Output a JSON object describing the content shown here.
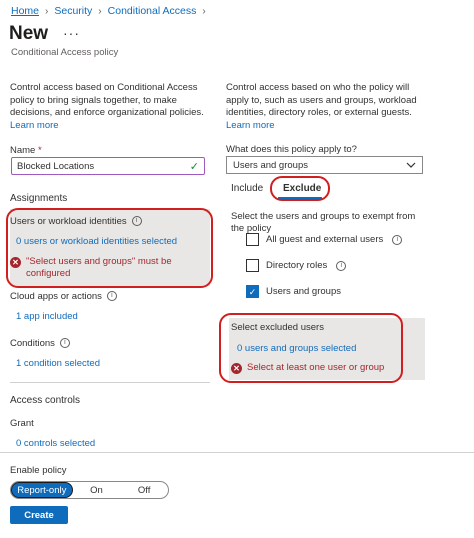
{
  "breadcrumb": {
    "items": [
      "Home",
      "Security",
      "Conditional Access"
    ]
  },
  "header": {
    "title": "New",
    "more_label": "···",
    "subtitle": "Conditional Access policy"
  },
  "left": {
    "description": "Control access based on Conditional Access policy to bring signals together, to make decisions, and enforce organizational policies.",
    "learn_more": "Learn more",
    "name_label": "Name",
    "required_mark": "*",
    "name_value": "Blocked Locations",
    "assignments_heading": "Assignments",
    "users": {
      "label": "Users or workload identities",
      "link": "0 users or workload identities selected",
      "error": "\"Select users and groups\" must be configured"
    },
    "cloud_apps": {
      "label": "Cloud apps or actions",
      "link": "1 app included"
    },
    "conditions": {
      "label": "Conditions",
      "link": "1 condition selected"
    },
    "access_controls_heading": "Access controls",
    "grant": {
      "label": "Grant",
      "link": "0 controls selected"
    }
  },
  "right": {
    "description": "Control access based on who the policy will apply to, such as users and groups, workload identities, directory roles, or external guests.",
    "learn_more": "Learn more",
    "apply_question": "What does this policy apply to?",
    "apply_value": "Users and groups",
    "tabs": [
      {
        "label": "Include"
      },
      {
        "label": "Exclude"
      }
    ],
    "exempt_instruction": "Select the users and groups to exempt from the policy",
    "checkboxes": [
      {
        "label": "All guest and external users",
        "checked": false,
        "info": true
      },
      {
        "label": "Directory roles",
        "checked": false,
        "info": true
      },
      {
        "label": "Users and groups",
        "checked": true,
        "info": false
      }
    ],
    "excluded": {
      "title": "Select excluded users",
      "link": "0 users and groups selected",
      "error": "Select at least one user or group"
    }
  },
  "footer": {
    "enable_label": "Enable policy",
    "toggle": [
      "Report-only",
      "On",
      "Off"
    ],
    "create_label": "Create"
  },
  "colors": {
    "accent": "#0f6cbd",
    "error": "#a4262c",
    "highlight_outline": "#d11e1e"
  }
}
